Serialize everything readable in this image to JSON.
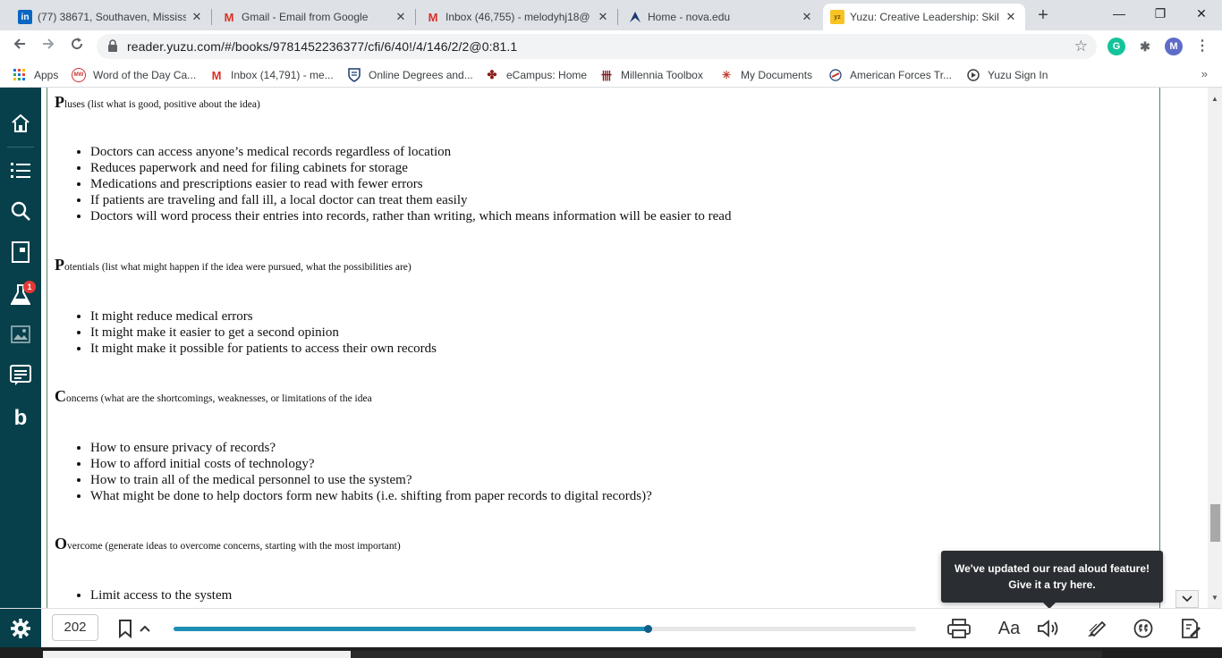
{
  "browser": {
    "tabs": [
      {
        "title": "(77) 38671, Southaven, Mississ",
        "favicon": "linkedin-icon",
        "active": false
      },
      {
        "title": "Gmail - Email from Google",
        "favicon": "gmail-icon",
        "active": false
      },
      {
        "title": "Inbox (46,755) - melodyhj18@",
        "favicon": "gmail-icon",
        "active": false
      },
      {
        "title": "Home - nova.edu",
        "favicon": "nova-shark-icon",
        "active": false
      },
      {
        "title": "Yuzu: Creative Leadership: Skil",
        "favicon": "yuzu-icon",
        "active": true
      }
    ],
    "new_tab_glyph": "+",
    "window_controls": {
      "minimize": "—",
      "restore": "❐",
      "close": "✕"
    },
    "url": "reader.yuzu.com/#/books/9781452236377/cfi/6/40!/4/146/2/2@0:81.1",
    "profile_initial": "M",
    "extension_initial": "G",
    "bookmarks": [
      {
        "label": "Apps",
        "icon": "apps-grid-icon"
      },
      {
        "label": "Word of the Day Ca...",
        "icon": "merriam-webster-icon"
      },
      {
        "label": "Inbox (14,791) - me...",
        "icon": "gmail-icon"
      },
      {
        "label": "Online Degrees and...",
        "icon": "shield-crest-icon"
      },
      {
        "label": "eCampus: Home",
        "icon": "ecampus-icon"
      },
      {
        "label": "Millennia Toolbox",
        "icon": "millennia-icon"
      },
      {
        "label": "My Documents",
        "icon": "documents-icon"
      },
      {
        "label": "American Forces Tr...",
        "icon": "forces-icon"
      },
      {
        "label": "Yuzu Sign In",
        "icon": "yuzu-signin-icon"
      }
    ],
    "bookmarks_more": "»"
  },
  "sidebar": {
    "items": [
      {
        "name": "home",
        "icon": "home-icon"
      },
      {
        "name": "contents",
        "icon": "list-icon"
      },
      {
        "name": "search",
        "icon": "search-icon"
      },
      {
        "name": "flashcards",
        "icon": "flashcard-icon"
      },
      {
        "name": "study-tools",
        "icon": "flask-icon",
        "badge": "1"
      },
      {
        "name": "images",
        "icon": "image-icon"
      },
      {
        "name": "notes",
        "icon": "notes-icon"
      },
      {
        "name": "bartleby",
        "icon": "bartleby-b-icon",
        "glyph": "b"
      }
    ]
  },
  "document": {
    "sections": [
      {
        "cap": "P",
        "rest": "luses (list what is good, positive about the idea)",
        "items": [
          "Doctors can access anyone’s medical records regardless of location",
          "Reduces paperwork and need for filing cabinets for storage",
          "Medications and prescriptions easier to read with fewer errors",
          "If patients are traveling and fall ill, a local doctor can treat them easily",
          "Doctors will word process their entries into records, rather than writing, which means information will be easier to read"
        ]
      },
      {
        "cap": "P",
        "rest": "otentials (list what might happen if the idea were pursued, what the possibilities are)",
        "items": [
          "It might reduce medical errors",
          "It might make it easier to get a second opinion",
          "It might make it possible for patients to access their own records"
        ]
      },
      {
        "cap": "C",
        "rest": "oncerns (what are the shortcomings, weaknesses, or limitations of the idea",
        "items": [
          "How to ensure privacy of records?",
          "How to afford initial costs of technology?",
          "How to train all of the medical personnel to use the system?",
          "What might be done to help doctors form new habits (i.e. shifting from paper records to digital records)?"
        ]
      },
      {
        "cap": "O",
        "rest": "vercome (generate ideas to overcome concerns, starting with the most important)",
        "items": [
          "Limit access to the system"
        ]
      }
    ]
  },
  "tooltip": {
    "line1": "We've updated our read aloud feature!",
    "line2": "Give it a try here."
  },
  "reader_bar": {
    "page_number": "202",
    "progress_fraction": 0.64,
    "font_label": "Aa",
    "accent_color": "#1c8fb4",
    "sidebar_color": "#07404b"
  }
}
